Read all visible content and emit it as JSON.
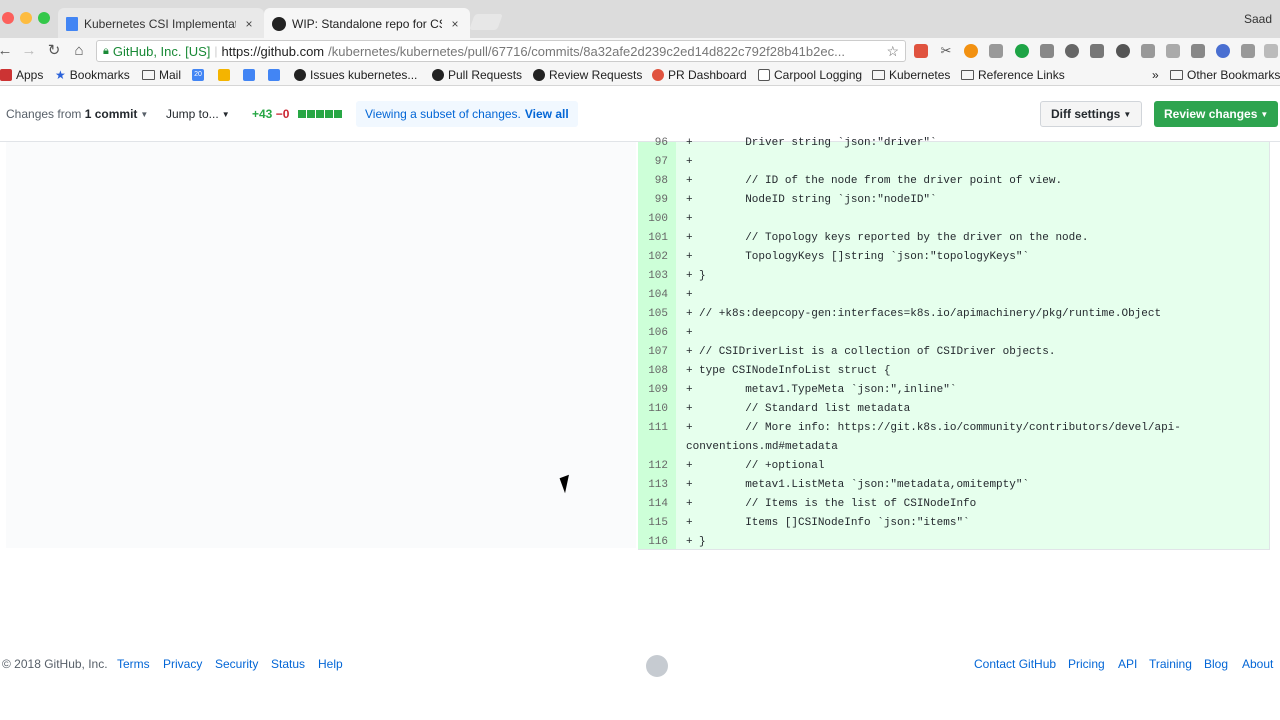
{
  "browser": {
    "tabs": [
      {
        "title": "Kubernetes CSI Implementatio",
        "close": "×"
      },
      {
        "title": "WIP: Standalone repo for CSI /",
        "close": "×"
      }
    ],
    "profile": "Saad",
    "address": {
      "ssl_org": "GitHub, Inc. [US]",
      "scheme_host": "https://github.com",
      "path": "/kubernetes/kubernetes/pull/67716/commits/8a32afe2d239c2ed14d822c792f28b41b2ec..."
    },
    "bookmarks": [
      {
        "label": "Apps"
      },
      {
        "label": "Bookmarks"
      },
      {
        "label": "Mail"
      },
      {
        "label": "20"
      },
      {
        "label": ""
      },
      {
        "label": ""
      },
      {
        "label": ""
      },
      {
        "label": "Issues kubernetes..."
      },
      {
        "label": "Pull Requests"
      },
      {
        "label": "Review Requests"
      },
      {
        "label": "PR Dashboard"
      },
      {
        "label": "Carpool Logging"
      },
      {
        "label": "Kubernetes"
      },
      {
        "label": "Reference Links"
      },
      {
        "label": "»"
      },
      {
        "label": "Other Bookmarks"
      }
    ]
  },
  "pr_header": {
    "changes_from_prefix": "Changes from",
    "changes_from_value": "1 commit",
    "jump_to": "Jump to...",
    "additions": "+43",
    "deletions": "−0",
    "subset_notice": "Viewing a subset of changes.",
    "view_all": "View all",
    "diff_settings": "Diff settings",
    "review_changes": "Review changes"
  },
  "diff": {
    "lines": [
      {
        "num": "96",
        "sign": "+",
        "code": "\tDriver string `json:\"driver\"`"
      },
      {
        "num": "97",
        "sign": "+",
        "code": ""
      },
      {
        "num": "98",
        "sign": "+",
        "code": "\t// ID of the node from the driver point of view."
      },
      {
        "num": "99",
        "sign": "+",
        "code": "\tNodeID string `json:\"nodeID\"`"
      },
      {
        "num": "100",
        "sign": "+",
        "code": ""
      },
      {
        "num": "101",
        "sign": "+",
        "code": "\t// Topology keys reported by the driver on the node."
      },
      {
        "num": "102",
        "sign": "+",
        "code": "\tTopologyKeys []string `json:\"topologyKeys\"`"
      },
      {
        "num": "103",
        "sign": "+",
        "code": "}"
      },
      {
        "num": "104",
        "sign": "+",
        "code": ""
      },
      {
        "num": "105",
        "sign": "+",
        "code": "// +k8s:deepcopy-gen:interfaces=k8s.io/apimachinery/pkg/runtime.Object"
      },
      {
        "num": "106",
        "sign": "+",
        "code": ""
      },
      {
        "num": "107",
        "sign": "+",
        "code": "// CSIDriverList is a collection of CSIDriver objects."
      },
      {
        "num": "108",
        "sign": "+",
        "code": "type CSINodeInfoList struct {"
      },
      {
        "num": "109",
        "sign": "+",
        "code": "\tmetav1.TypeMeta `json:\",inline\"`"
      },
      {
        "num": "110",
        "sign": "+",
        "code": "\t// Standard list metadata"
      },
      {
        "num": "111",
        "sign": "+",
        "code": "\t// More info: https://git.k8s.io/community/contributors/devel/api-"
      },
      {
        "num": "",
        "sign": "",
        "code": "conventions.md#metadata"
      },
      {
        "num": "112",
        "sign": "+",
        "code": "\t// +optional"
      },
      {
        "num": "113",
        "sign": "+",
        "code": "\tmetav1.ListMeta `json:\"metadata,omitempty\"`"
      },
      {
        "num": "114",
        "sign": "+",
        "code": "\t// Items is the list of CSINodeInfo"
      },
      {
        "num": "115",
        "sign": "+",
        "code": "\tItems []CSINodeInfo `json:\"items\"`"
      },
      {
        "num": "116",
        "sign": "+",
        "code": "}"
      }
    ]
  },
  "footer": {
    "copyright": "© 2018 GitHub, Inc.",
    "left_links": [
      "Terms",
      "Privacy",
      "Security",
      "Status",
      "Help"
    ],
    "right_links": [
      "Contact GitHub",
      "Pricing",
      "API",
      "Training",
      "Blog",
      "About"
    ]
  },
  "colors": {
    "addition_bg": "#e6ffed",
    "addition_gutter": "#cdffd8",
    "link": "#0366d6",
    "review_button": "#2ea44f"
  }
}
